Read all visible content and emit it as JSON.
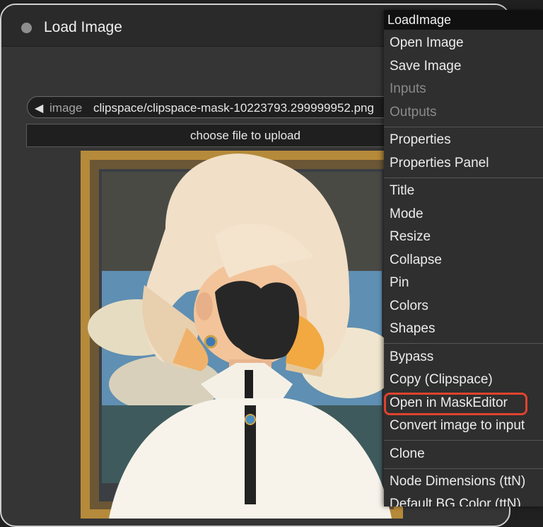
{
  "node": {
    "title": "Load Image",
    "image_widget": {
      "arrow": "◀",
      "name": "image",
      "value": "clipspace/clipspace-mask-10223793.299999952.png"
    },
    "upload_label": "choose file to upload"
  },
  "context_menu": {
    "title": "LoadImage",
    "items": [
      {
        "label": "Open Image",
        "enabled": true
      },
      {
        "label": "Save Image",
        "enabled": true
      },
      {
        "label": "Inputs",
        "enabled": false
      },
      {
        "label": "Outputs",
        "enabled": false
      },
      {
        "label": "Properties",
        "enabled": true
      },
      {
        "label": "Properties Panel",
        "enabled": true
      },
      {
        "label": "Title",
        "enabled": true
      },
      {
        "label": "Mode",
        "enabled": true
      },
      {
        "label": "Resize",
        "enabled": true
      },
      {
        "label": "Collapse",
        "enabled": true
      },
      {
        "label": "Pin",
        "enabled": true
      },
      {
        "label": "Colors",
        "enabled": true
      },
      {
        "label": "Shapes",
        "enabled": true
      },
      {
        "label": "Bypass",
        "enabled": true
      },
      {
        "label": "Copy (Clipspace)",
        "enabled": true
      },
      {
        "label": "Open in MaskEditor",
        "enabled": true,
        "highlighted": true
      },
      {
        "label": "Convert image to input",
        "enabled": true
      },
      {
        "label": "Clone",
        "enabled": true
      },
      {
        "label": "Node Dimensions (ttN)",
        "enabled": true
      },
      {
        "label": "Default BG Color (ttN)",
        "enabled": true
      }
    ]
  },
  "colors": {
    "highlight_border": "#e0432e",
    "menu_background": "#2f2f2f",
    "node_background": "#353535"
  }
}
